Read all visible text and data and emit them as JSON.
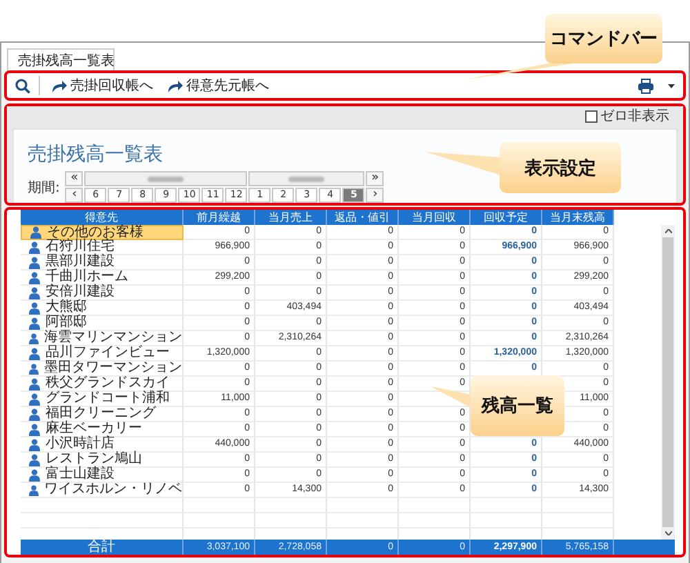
{
  "callouts": [
    {
      "text": "コマンドバー"
    },
    {
      "text": "表示設定"
    },
    {
      "text": "残高一覧"
    }
  ],
  "tab": {
    "label": "売掛残高一覧表",
    "selected": true
  },
  "toolbar": {
    "buttons": [
      {
        "label": "売掛回収帳へ"
      },
      {
        "label": "得意先元帳へ"
      }
    ]
  },
  "settings": {
    "zero_hide": {
      "label": "ゼロ非表示",
      "checked": false
    },
    "title": "売掛残高一覧表",
    "period_label": "期間:",
    "prev_year": "«",
    "next_year": "»",
    "prev": "‹",
    "next": "›",
    "months": [
      {
        "label": "6",
        "selected": false
      },
      {
        "label": "7",
        "selected": false
      },
      {
        "label": "8",
        "selected": false
      },
      {
        "label": "9",
        "selected": false
      },
      {
        "label": "10",
        "selected": false
      },
      {
        "label": "11",
        "selected": false
      },
      {
        "label": "12",
        "selected": false
      },
      {
        "label": "1",
        "selected": false
      },
      {
        "label": "2",
        "selected": false
      },
      {
        "label": "3",
        "selected": false
      },
      {
        "label": "4",
        "selected": false
      },
      {
        "label": "5",
        "selected": true
      }
    ]
  },
  "table": {
    "columns": [
      "得意先",
      "前月繰越",
      "当月売上",
      "返品・値引",
      "当月回収",
      "回収予定",
      "当月末残高"
    ],
    "rows": [
      {
        "name": "その他のお客様",
        "selected": true,
        "values": [
          "0",
          "0",
          "0",
          "0",
          "0",
          "0"
        ]
      },
      {
        "name": "石狩川住宅",
        "selected": false,
        "values": [
          "966,900",
          "0",
          "0",
          "0",
          "966,900",
          "966,900"
        ]
      },
      {
        "name": "黒部川建設",
        "selected": false,
        "values": [
          "0",
          "0",
          "0",
          "0",
          "0",
          "0"
        ]
      },
      {
        "name": "千曲川ホーム",
        "selected": false,
        "values": [
          "299,200",
          "0",
          "0",
          "0",
          "0",
          "299,200"
        ]
      },
      {
        "name": "安倍川建設",
        "selected": false,
        "values": [
          "0",
          "0",
          "0",
          "0",
          "0",
          "0"
        ]
      },
      {
        "name": "大熊邸",
        "selected": false,
        "values": [
          "0",
          "403,494",
          "0",
          "0",
          "0",
          "403,494"
        ]
      },
      {
        "name": "阿部邸",
        "selected": false,
        "values": [
          "0",
          "0",
          "0",
          "0",
          "0",
          "0"
        ]
      },
      {
        "name": "海雲マリンマンション",
        "selected": false,
        "values": [
          "0",
          "2,310,264",
          "0",
          "0",
          "0",
          "2,310,264"
        ]
      },
      {
        "name": "品川ファインビュー",
        "selected": false,
        "values": [
          "1,320,000",
          "0",
          "0",
          "0",
          "1,320,000",
          "1,320,000"
        ]
      },
      {
        "name": "墨田タワーマンション",
        "selected": false,
        "values": [
          "0",
          "0",
          "0",
          "0",
          "0",
          "0"
        ]
      },
      {
        "name": "秩父グランドスカイ",
        "selected": false,
        "values": {
          "previous_balance": "0",
          "sales": "0",
          "returns_discounts": "0",
          "collected": "0",
          "ending_balance": "0"
        }
      },
      {
        "name": "グランドコート浦和",
        "selected": false,
        "values": {
          "previous_balance": "11,000",
          "sales": "0",
          "returns_discounts": "0",
          "ending_balance": "11,000"
        }
      },
      {
        "name": "福田クリーニング",
        "selected": false,
        "values": {
          "previous_balance": "0",
          "sales": "0",
          "returns_discounts": "0",
          "collected": "0",
          "ending_balance": "0"
        }
      },
      {
        "name": "麻生ベーカリー",
        "selected": false,
        "values": {
          "previous_balance": "0",
          "sales": "0",
          "returns_discounts": "0",
          "collected": "0",
          "ending_balance": "0"
        }
      },
      {
        "name": "小沢時計店",
        "selected": false,
        "values": [
          "440,000",
          "0",
          "0",
          "0",
          "0",
          "440,000"
        ]
      },
      {
        "name": "レストラン鳩山",
        "selected": false,
        "values": [
          "0",
          "0",
          "0",
          "0",
          "0",
          "0"
        ]
      },
      {
        "name": "富士山建設",
        "selected": false,
        "values": [
          "0",
          "0",
          "0",
          "0",
          "0",
          "0"
        ]
      },
      {
        "name": "ワイスホルン・リノベ",
        "selected": false,
        "values": [
          "0",
          "14,300",
          "0",
          "0",
          "0",
          "14,300"
        ]
      }
    ],
    "total": {
      "label": "合計",
      "values": [
        "3,037,100",
        "2,728,058",
        "0",
        "0",
        "2,297,900",
        "5,765,158"
      ]
    }
  }
}
